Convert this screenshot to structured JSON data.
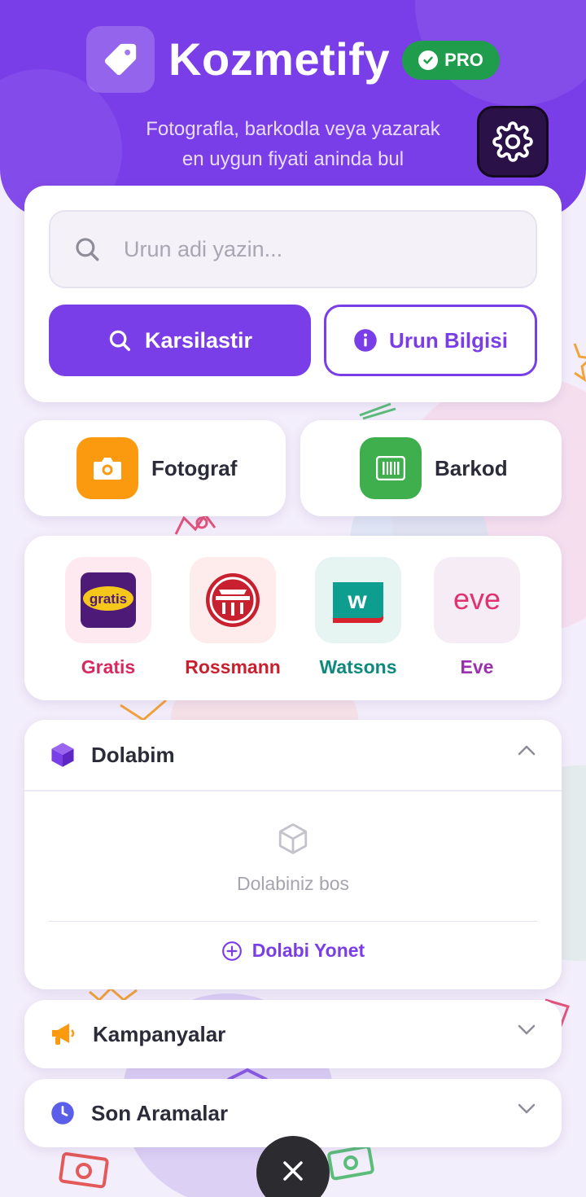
{
  "app": {
    "title": "Kozmetify",
    "pro_label": "PRO",
    "subtitle_line1": "Fotografla, barkodla veya yazarak",
    "subtitle_line2": "en uygun fiyati aninda bul"
  },
  "search": {
    "placeholder": "Urun adi yazin...",
    "compare_label": "Karsilastir",
    "info_label": "Urun Bilgisi"
  },
  "quick_actions": {
    "photo_label": "Fotograf",
    "barcode_label": "Barkod"
  },
  "stores": [
    {
      "name": "Gratis",
      "logo_text": "gratis",
      "color": "#d7295f"
    },
    {
      "name": "Rossmann",
      "color": "#c8202f"
    },
    {
      "name": "Watsons",
      "logo_text": "w",
      "color": "#0e8a7d"
    },
    {
      "name": "Eve",
      "logo_text": "eve",
      "color": "#9b2fae"
    }
  ],
  "dolabim": {
    "title": "Dolabim",
    "empty_text": "Dolabiniz bos",
    "manage_label": "Dolabi Yonet"
  },
  "kampanyalar": {
    "title": "Kampanyalar"
  },
  "son_aramalar": {
    "title": "Son Aramalar"
  },
  "colors": {
    "accent": "#7a3ee8",
    "pro_green": "#1f9d4d",
    "photo_orange": "#fb9a0f",
    "barcode_green": "#3fae4c"
  }
}
